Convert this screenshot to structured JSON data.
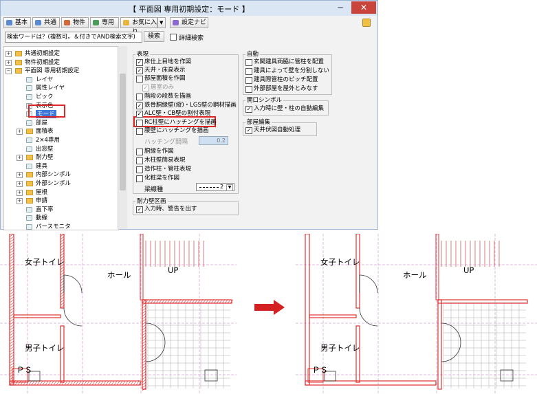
{
  "window": {
    "title": "【 平面図 専用初期設定：モード 】",
    "minimize": "─",
    "close": "✕"
  },
  "toolbar": {
    "buttons": [
      "基本",
      "共通",
      "物件",
      "専用",
      "お気に入り"
    ],
    "dropdown": "▼",
    "navi": "設定ナビ"
  },
  "search": {
    "value": "検索ワードは？(複数可。＆付きでAND検索文字)",
    "button": "検索",
    "detail_label": "詳細検索"
  },
  "tree": {
    "items": [
      {
        "label": "共通初期設定",
        "kind": "folder",
        "exp": "+"
      },
      {
        "label": "物件初期設定",
        "kind": "folder",
        "exp": "+"
      },
      {
        "label": "平面図 専用初期設定",
        "kind": "folder",
        "exp": "−"
      },
      {
        "label": "レイヤ",
        "kind": "leaf"
      },
      {
        "label": "属性レイヤ",
        "kind": "leaf"
      },
      {
        "label": "ピック",
        "kind": "leaf"
      },
      {
        "label": "表示色",
        "kind": "leaf"
      },
      {
        "label": "モード",
        "kind": "leaf"
      },
      {
        "label": "部屋",
        "kind": "leaf"
      },
      {
        "label": "面積表",
        "kind": "folder",
        "exp": "+"
      },
      {
        "label": "2×4専用",
        "kind": "leaf"
      },
      {
        "label": "出窓壁",
        "kind": "leaf"
      },
      {
        "label": "耐力壁",
        "kind": "folder",
        "exp": "+"
      },
      {
        "label": "建具",
        "kind": "leaf"
      },
      {
        "label": "内部シンボル",
        "kind": "folder",
        "exp": "+"
      },
      {
        "label": "外部シンボル",
        "kind": "folder",
        "exp": "+"
      },
      {
        "label": "屋根",
        "kind": "folder",
        "exp": "+"
      },
      {
        "label": "申請",
        "kind": "folder",
        "exp": "+"
      },
      {
        "label": "直下率",
        "kind": "leaf"
      },
      {
        "label": "動線",
        "kind": "leaf"
      },
      {
        "label": "パースモニタ",
        "kind": "leaf"
      }
    ]
  },
  "groups": {
    "hyogen": {
      "title": "表現",
      "options": [
        {
          "label": "床仕上目地を作図",
          "checked": true
        },
        {
          "label": "天井・床高表示",
          "checked": true
        },
        {
          "label": "部屋面積を作図",
          "checked": false
        },
        {
          "label": "居室のみ",
          "checked": true
        },
        {
          "label": "階段の段数を描画",
          "checked": false
        },
        {
          "label": "鉄骨胴縁壁(縦)・LGS壁の鋼材描画",
          "checked": true
        },
        {
          "label": "ALC壁・CB壁の割付表現",
          "checked": true
        },
        {
          "label": "RC柱壁にハッチングを描画",
          "checked": false
        },
        {
          "label": "腰壁にハッチングを描画",
          "checked": false
        }
      ],
      "hatch_label": "ハッチング間隔",
      "hatch_value": "0.2",
      "options2": [
        {
          "label": "胴縁を作図",
          "checked": false
        },
        {
          "label": "木柱壁簡易表現",
          "checked": false
        },
        {
          "label": "造作柱・管柱表現",
          "checked": false
        },
        {
          "label": "化粧梁を作図",
          "checked": false
        }
      ],
      "linetype_label": "梁線種",
      "linetype_value": "2"
    },
    "jido": {
      "title": "自動",
      "options": [
        {
          "label": "玄関建具両脇に管柱を配置",
          "checked": false
        },
        {
          "label": "建具によって壁を分割しない",
          "checked": false
        },
        {
          "label": "建具際管柱のピッチ配置",
          "checked": false
        },
        {
          "label": "外部部屋を屋外とみなす",
          "checked": false
        }
      ]
    },
    "kaiko": {
      "title": "開口シンボル",
      "options": [
        {
          "label": "入力時に壁・柱の自動編集",
          "checked": true
        }
      ]
    },
    "heya": {
      "title": "部屋編集",
      "options": [
        {
          "label": "天井伏図自動処理",
          "checked": true
        }
      ]
    },
    "tairyoku": {
      "title": "耐力壁区画",
      "options": [
        {
          "label": "入力時、警告を出す",
          "checked": true
        }
      ]
    }
  },
  "plans": {
    "left": {
      "women": "女子トイレ",
      "hall": "ホール",
      "up": "UP",
      "men": "男子トイレ",
      "ps": "ＰＳ",
      "hatched": true
    },
    "right": {
      "women": "女子トイレ",
      "hall": "ホール",
      "up": "UP",
      "men": "男子トイレ",
      "ps": "ＰＳ",
      "hatched": false
    }
  },
  "arrow": {
    "color": "#d42020"
  }
}
